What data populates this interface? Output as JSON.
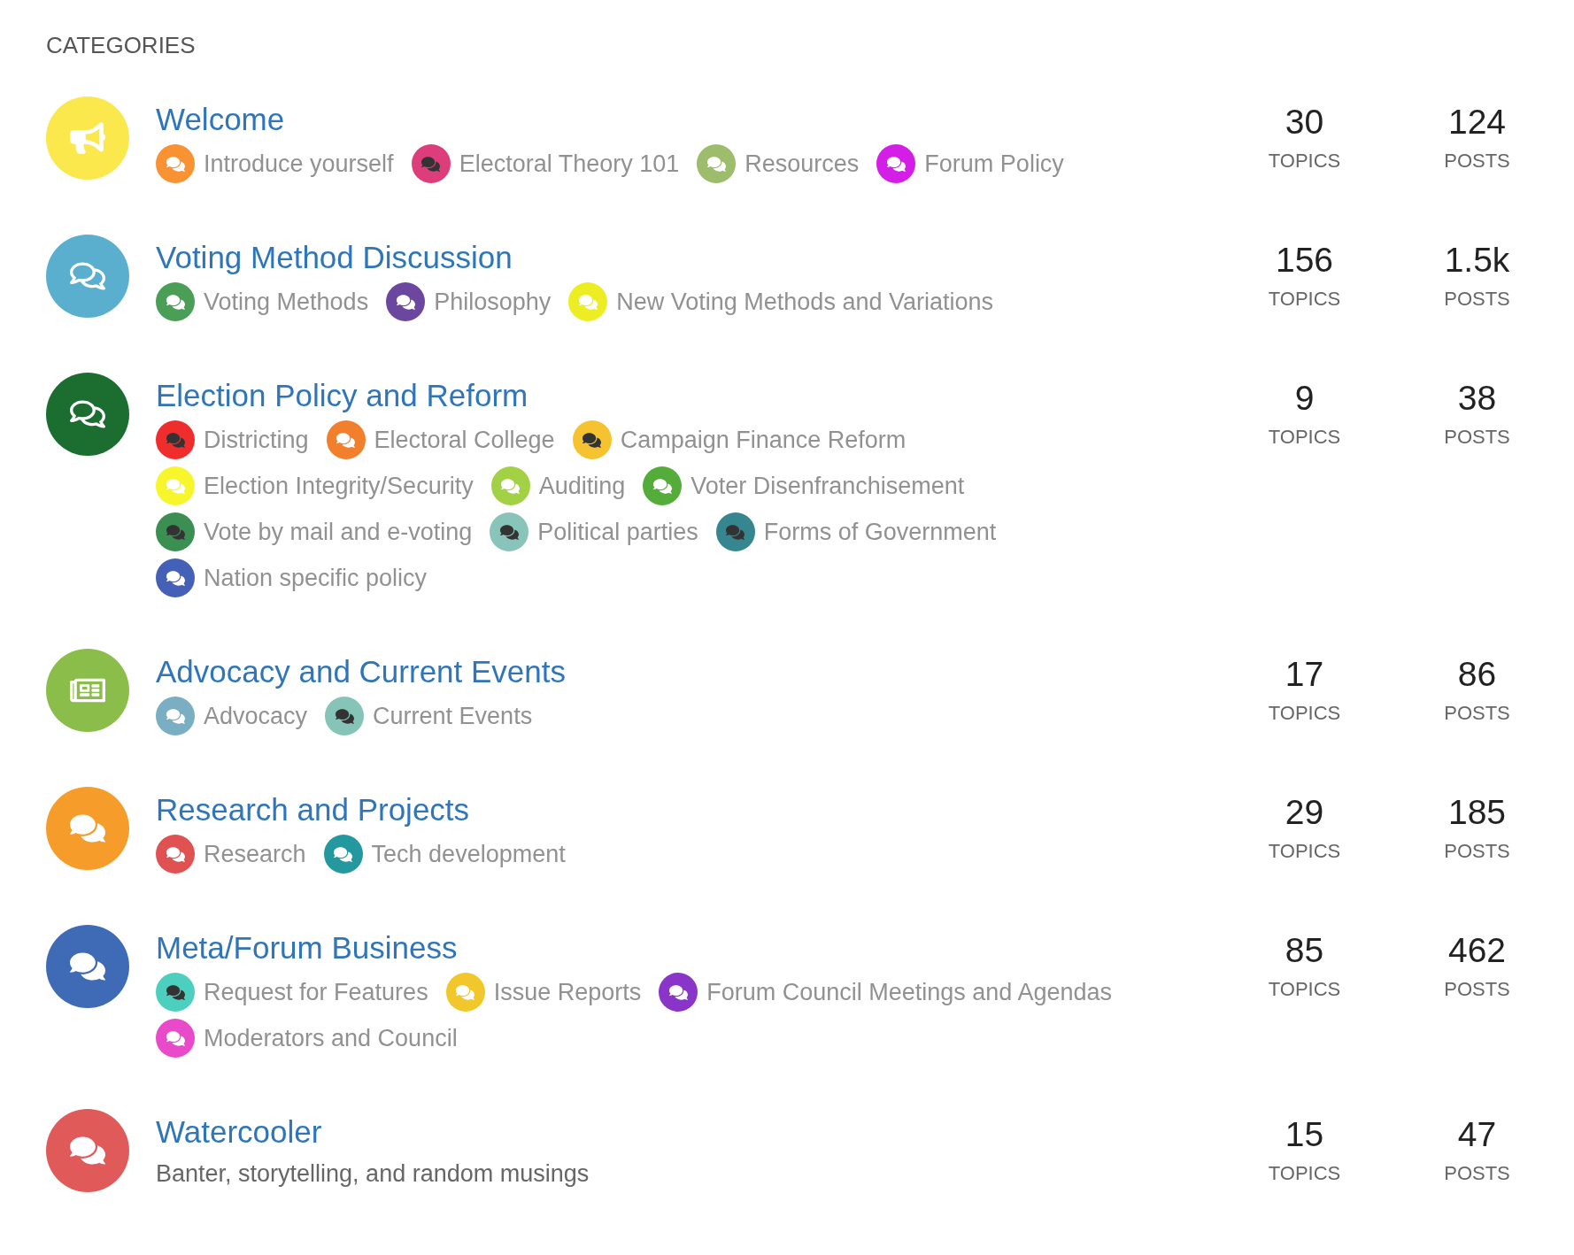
{
  "heading": "CATEGORIES",
  "categories": [
    {
      "name": "Welcome",
      "kind": "announcement",
      "color": "#fbe84d",
      "topics": "30",
      "topics_label": "TOPICS",
      "posts": "124",
      "posts_label": "POSTS",
      "subcategories": [
        {
          "name": "Introduce yourself",
          "color": "#f99232",
          "dark_icon": false
        },
        {
          "name": "Electoral Theory 101",
          "color": "#dd3d7b",
          "dark_icon": true
        },
        {
          "name": "Resources",
          "color": "#9dbc6c",
          "dark_icon": false
        },
        {
          "name": "Forum Policy",
          "color": "#d41ee8",
          "dark_icon": false
        }
      ]
    },
    {
      "name": "Voting Method Discussion",
      "kind": "discussion_outline",
      "color": "#5aafcf",
      "topics": "156",
      "topics_label": "TOPICS",
      "posts": "1.5k",
      "posts_label": "POSTS",
      "subcategories": [
        {
          "name": "Voting Methods",
          "color": "#4a9e56",
          "dark_icon": false
        },
        {
          "name": "Philosophy",
          "color": "#6c47a0",
          "dark_icon": false
        },
        {
          "name": "New Voting Methods and Variations",
          "color": "#eded24",
          "dark_icon": false
        }
      ]
    },
    {
      "name": "Election Policy and Reform",
      "kind": "discussion_outline",
      "color": "#1c6e30",
      "topics": "9",
      "topics_label": "TOPICS",
      "posts": "38",
      "posts_label": "POSTS",
      "subcategories": [
        {
          "name": "Districting",
          "color": "#ef2d2d",
          "dark_icon": true
        },
        {
          "name": "Electoral College",
          "color": "#f17f2b",
          "dark_icon": false
        },
        {
          "name": "Campaign Finance Reform",
          "color": "#f5c330",
          "dark_icon": true
        },
        {
          "name": "Election Integrity/Security",
          "color": "#f7f52c",
          "dark_icon": false
        },
        {
          "name": "Auditing",
          "color": "#a3d145",
          "dark_icon": false
        },
        {
          "name": "Voter Disenfranchisement",
          "color": "#54ac3b",
          "dark_icon": false
        },
        {
          "name": "Vote by mail and e-voting",
          "color": "#3b8f52",
          "dark_icon": true
        },
        {
          "name": "Political parties",
          "color": "#88c4b9",
          "dark_icon": true
        },
        {
          "name": "Forms of Government",
          "color": "#35868f",
          "dark_icon": true
        },
        {
          "name": "Nation specific policy",
          "color": "#4560b7",
          "dark_icon": false
        }
      ]
    },
    {
      "name": "Advocacy and Current Events",
      "kind": "news",
      "color": "#8bbd4a",
      "topics": "17",
      "topics_label": "TOPICS",
      "posts": "86",
      "posts_label": "POSTS",
      "subcategories": [
        {
          "name": "Advocacy",
          "color": "#7aaec2",
          "dark_icon": false
        },
        {
          "name": "Current Events",
          "color": "#86c4b8",
          "dark_icon": true
        }
      ]
    },
    {
      "name": "Research and Projects",
      "kind": "discussion",
      "color": "#f59c2b",
      "topics": "29",
      "topics_label": "TOPICS",
      "posts": "185",
      "posts_label": "POSTS",
      "subcategories": [
        {
          "name": "Research",
          "color": "#e05252",
          "dark_icon": false
        },
        {
          "name": "Tech development",
          "color": "#23989e",
          "dark_icon": false
        }
      ]
    },
    {
      "name": "Meta/Forum Business",
      "kind": "discussion",
      "color": "#3f6ab5",
      "topics": "85",
      "topics_label": "TOPICS",
      "posts": "462",
      "posts_label": "POSTS",
      "subcategories": [
        {
          "name": "Request for Features",
          "color": "#4dcfbf",
          "dark_icon": true
        },
        {
          "name": "Issue Reports",
          "color": "#f1c72b",
          "dark_icon": false
        },
        {
          "name": "Forum Council Meetings and Agendas",
          "color": "#8a35c9",
          "dark_icon": false
        },
        {
          "name": "Moderators and Council",
          "color": "#e84ac9",
          "dark_icon": false
        }
      ]
    },
    {
      "name": "Watercooler",
      "kind": "discussion",
      "color": "#e05a5a",
      "topics": "15",
      "topics_label": "TOPICS",
      "posts": "47",
      "posts_label": "POSTS",
      "description": "Banter, storytelling, and random musings"
    }
  ]
}
